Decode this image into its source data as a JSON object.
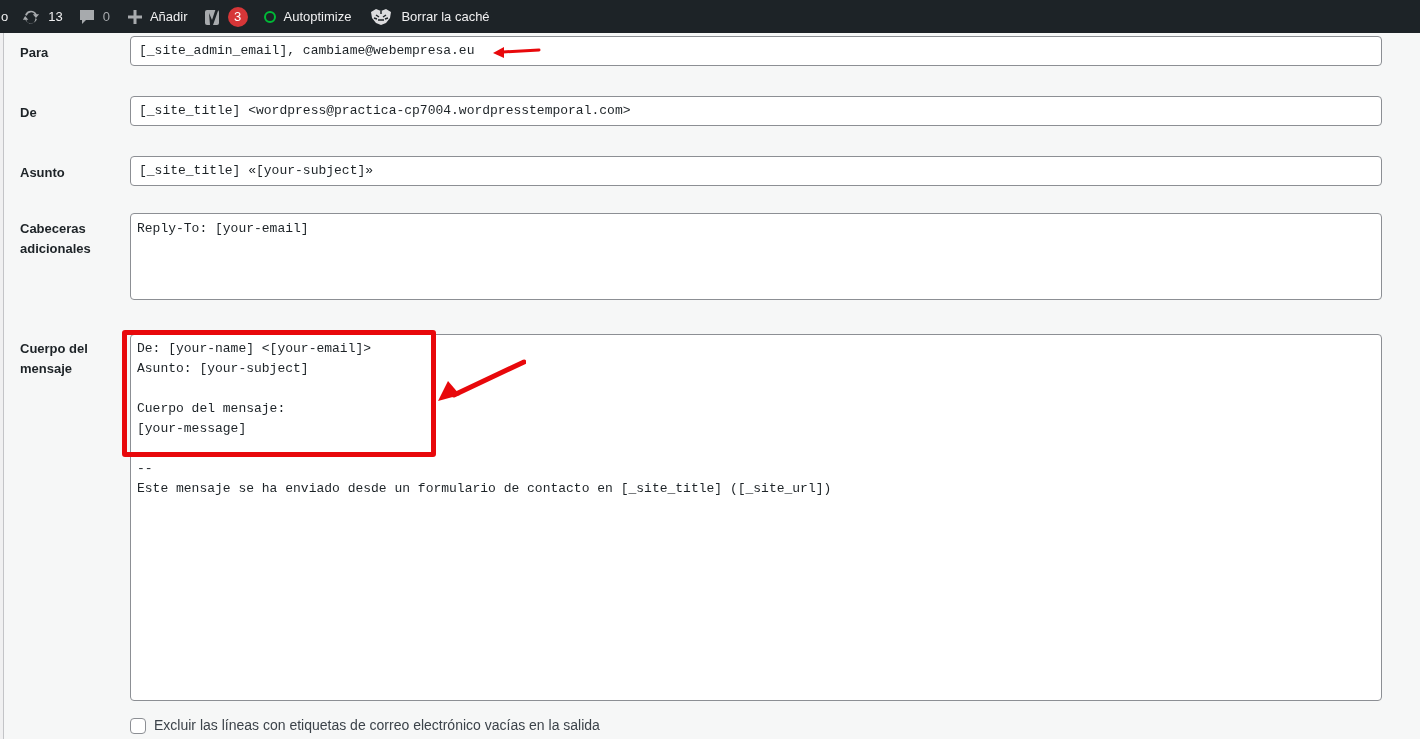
{
  "admin_bar": {
    "cut_item": "o",
    "updates": "13",
    "comments": "0",
    "new": "Añadir",
    "seo_badge": "3",
    "autoptimize": "Autoptimize",
    "cache": "Borrar la caché"
  },
  "fields": [
    {
      "label": "Para",
      "value": "[_site_admin_email], cambiame@webempresa.eu",
      "arrow": true
    },
    {
      "label": "De",
      "value": "[_site_title] <wordpress@practica-cp7004.wordpresstemporal.com>",
      "arrow": false
    },
    {
      "label": "Asunto",
      "value": "[_site_title] «[your-subject]»",
      "arrow": false
    }
  ],
  "headers": {
    "label": "Cabeceras adicionales",
    "value": "Reply-To: [your-email]"
  },
  "body": {
    "label": "Cuerpo del mensaje",
    "paragraphs": [
      [
        "De: [your-name] <[your-email]>",
        "Asunto: [your-subject]"
      ],
      [
        "Cuerpo del mensaje:",
        "[your-message]"
      ],
      [
        "--",
        "Este mensaje se ha enviado desde un formulario de contacto en [_site_title] ([_site_url])"
      ]
    ]
  },
  "exclude_blank": {
    "label": "Excluir las líneas con etiquetas de correo electrónico vacías en la salida",
    "checked": false
  }
}
